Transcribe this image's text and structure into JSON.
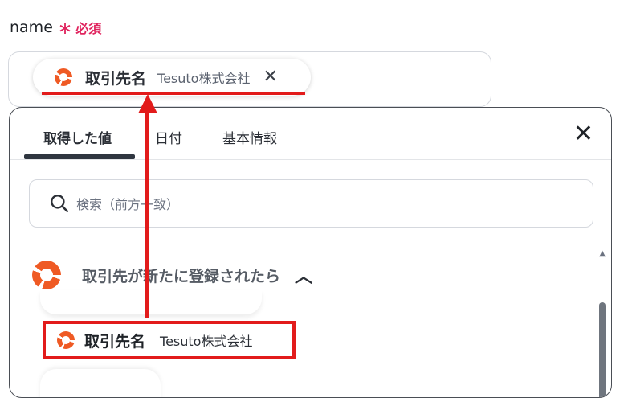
{
  "field": {
    "label": "name",
    "required_mark": "∗",
    "required_text": "必須"
  },
  "chip": {
    "title": "取引先名",
    "subtitle": "Tesuto株式会社",
    "icon": "lifebuoy-icon",
    "close_icon": "close-icon"
  },
  "panel": {
    "tabs": [
      {
        "label": "取得した値",
        "active": true
      },
      {
        "label": "日付",
        "active": false
      },
      {
        "label": "基本情報",
        "active": false
      }
    ],
    "close_icon": "close-icon",
    "search": {
      "placeholder": "検索（前方一致）",
      "icon": "search-icon"
    },
    "group": {
      "title": "取引先が新たに登録されたら",
      "icon": "lifebuoy-icon",
      "expanded": true
    },
    "item": {
      "title": "取引先名",
      "subtitle": "Tesuto株式会社",
      "icon": "lifebuoy-icon"
    }
  },
  "colors": {
    "accent_red": "#e21b1b",
    "brand_orange": "#ef5a24",
    "required_pink": "#e0245e"
  }
}
